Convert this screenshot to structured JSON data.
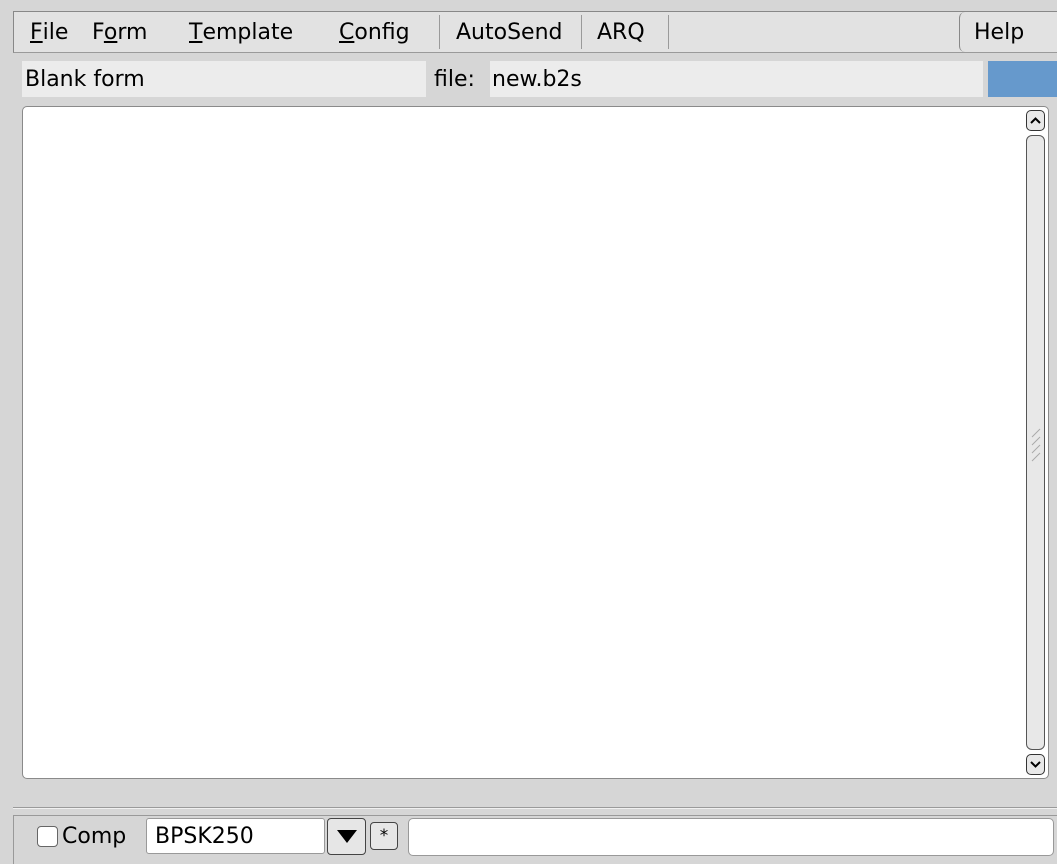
{
  "menu": {
    "file": {
      "label": "File"
    },
    "form": {
      "label": "Form"
    },
    "template": {
      "label": "Template"
    },
    "config": {
      "label": "Config"
    },
    "autosend": {
      "label": "AutoSend"
    },
    "arq": {
      "label": "ARQ"
    },
    "help": {
      "label": "Help"
    }
  },
  "info": {
    "form_name": "Blank form",
    "file_label": "file:",
    "file_name": "new.b2s"
  },
  "bottom": {
    "comp_label": "Comp",
    "comp_checked": false,
    "mode_value": "BPSK250",
    "star_label": "*"
  },
  "colors": {
    "indicator": "#6699cc",
    "background": "#d6d6d6"
  },
  "icons": {
    "scroll_up": "chevron-up-icon",
    "scroll_down": "chevron-down-icon",
    "dropdown": "triangle-down-icon"
  }
}
